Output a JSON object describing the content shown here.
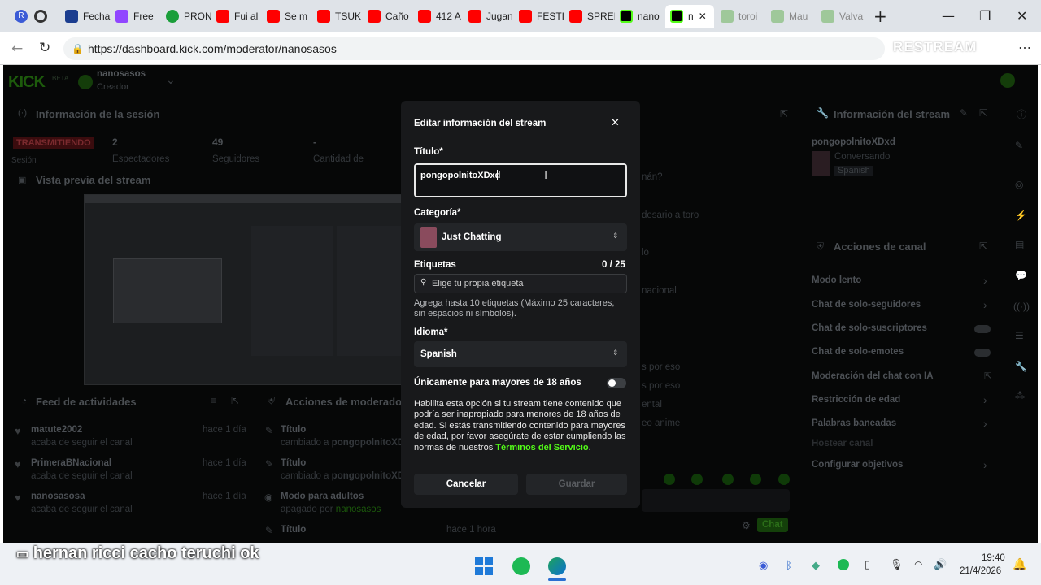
{
  "browser": {
    "tabs": [
      "Fecha",
      "Free",
      "PRON",
      "Fui al",
      "Se m",
      "TSUK",
      "Caño",
      "412 A",
      "Jugan",
      "FESTI",
      "SPREI",
      "nano",
      "n",
      "toroi",
      "Mau",
      "Valva"
    ],
    "url": "https://dashboard.kick.com/moderator/nanosasos",
    "watermark": "RESTREAM"
  },
  "header": {
    "logo": "KICK",
    "beta": "BETA",
    "channel": "nanosasos",
    "role": "Creador"
  },
  "session": {
    "title": "Información de la sesión",
    "live_badge": "TRANSMITIENDO",
    "live_sub": "Sesión",
    "viewers_value": "2",
    "viewers_label": "Espectadores",
    "followers_value": "49",
    "followers_label": "Seguidores",
    "other_value": "-",
    "other_label": "Cantidad de"
  },
  "preview": {
    "title": "Vista previa del stream"
  },
  "activity": {
    "title": "Feed de actividades",
    "items": [
      {
        "name": "matute2002",
        "action": "acaba de seguir el canal",
        "time": "hace 1 día"
      },
      {
        "name": "PrimeraBNacional",
        "action": "acaba de seguir el canal",
        "time": "hace 1 día"
      },
      {
        "name": "nanosasosa",
        "action": "acaba de seguir el canal",
        "time": "hace 1 día"
      }
    ]
  },
  "mod_actions": {
    "title": "Acciones de moderador",
    "items": [
      {
        "name": "Título",
        "prefix": "cambiado a",
        "value": "pongopolnitoXDxd"
      },
      {
        "name": "Título",
        "prefix": "cambiado a",
        "value": "pongopolnitoXDx"
      },
      {
        "name": "Modo para adultos",
        "prefix": "apagado por",
        "value": "nanosasos"
      },
      {
        "name": "Título",
        "time": "hace 1 hora"
      }
    ]
  },
  "chat_fragments": [
    "nán?",
    "desario a toro",
    "lo",
    "nacional",
    "s por eso",
    "s por eso",
    "ental",
    "eo anime"
  ],
  "chat_send": "Chat",
  "stream_info": {
    "title": "Información del stream",
    "stream_title": "pongopolnitoXDxd",
    "category": "Conversando",
    "language": "Spanish"
  },
  "channel_actions": {
    "title": "Acciones de canal",
    "items": [
      "Modo lento",
      "Chat de solo-seguidores",
      "Chat de solo-suscriptores",
      "Chat de solo-emotes",
      "Moderación del chat con IA",
      "Restricción de edad",
      "Palabras baneadas",
      "Hostear canal",
      "Configurar objetivos"
    ]
  },
  "modal": {
    "title": "Editar información del stream",
    "title_label": "Título*",
    "title_value": "pongopolnitoXDxd",
    "category_label": "Categoría*",
    "category_value": "Just Chatting",
    "tags_label": "Etiquetas",
    "tags_count": "0 / 25",
    "tags_placeholder": "Elige tu propia etiqueta",
    "tags_help": "Agrega hasta 10 etiquetas (Máximo 25 caracteres, sin espacios ni símbolos).",
    "language_label": "Idioma*",
    "language_value": "Spanish",
    "adult_label": "Únicamente para mayores de 18 años",
    "adult_help": "Habilita esta opción si tu stream tiene contenido que podría ser inapropiado para menores de 18 años de edad. Si estás transmitiendo contenido para mayores de edad, por favor asegúrate de estar cumpliendo las normas de nuestros",
    "terms_link": "Términos del Servicio",
    "cancel": "Cancelar",
    "save": "Guardar"
  },
  "caption": "hernan ricci cacho teruchi ok",
  "taskbar": {
    "time": "19:40",
    "date": "21/4/2026"
  },
  "colors": {
    "kick_green": "#53fc18",
    "live_red": "#e0262f",
    "modal_bg": "#18191b"
  }
}
